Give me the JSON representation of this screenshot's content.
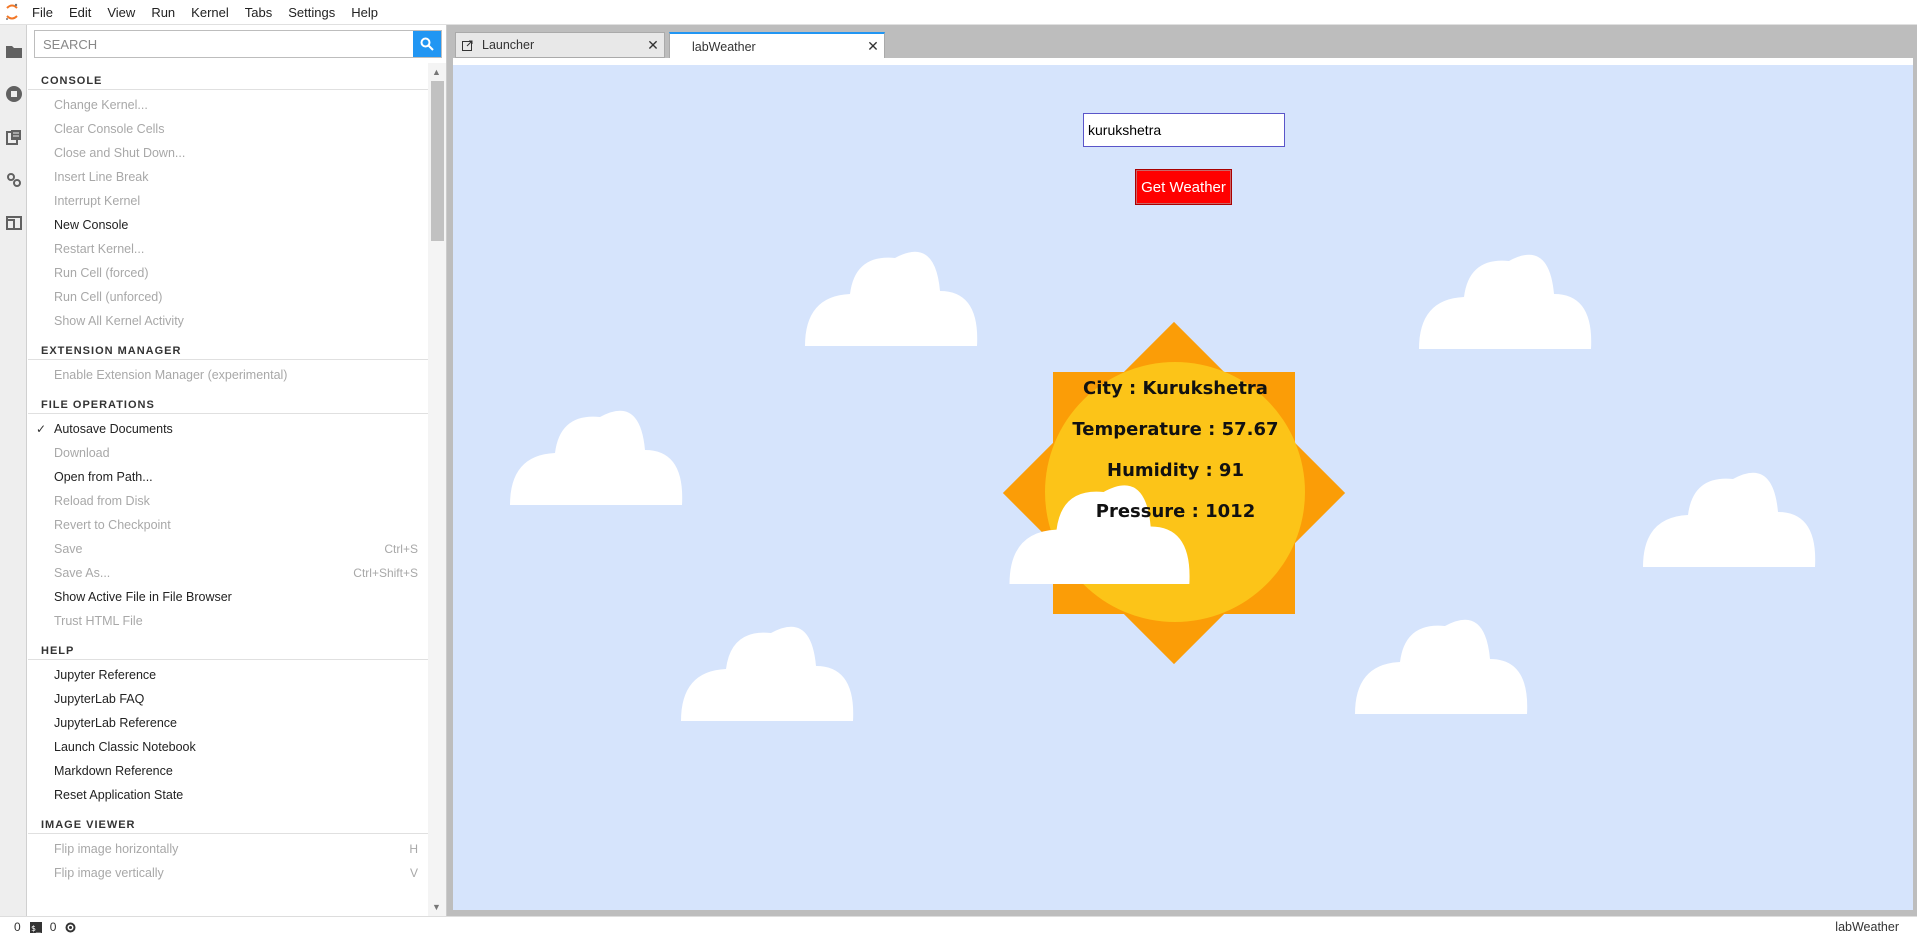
{
  "menubar": {
    "items": [
      "File",
      "Edit",
      "View",
      "Run",
      "Kernel",
      "Tabs",
      "Settings",
      "Help"
    ]
  },
  "activity_icons": [
    "folder-icon",
    "running-stop-icon",
    "commands-icon",
    "property-inspector-icon",
    "tabs-icon"
  ],
  "palette": {
    "search_placeholder": "SEARCH",
    "sections": [
      {
        "title": "CONSOLE",
        "items": [
          {
            "label": "Change Kernel...",
            "enabled": false
          },
          {
            "label": "Clear Console Cells",
            "enabled": false
          },
          {
            "label": "Close and Shut Down...",
            "enabled": false
          },
          {
            "label": "Insert Line Break",
            "enabled": false
          },
          {
            "label": "Interrupt Kernel",
            "enabled": false
          },
          {
            "label": "New Console",
            "enabled": true
          },
          {
            "label": "Restart Kernel...",
            "enabled": false
          },
          {
            "label": "Run Cell (forced)",
            "enabled": false
          },
          {
            "label": "Run Cell (unforced)",
            "enabled": false
          },
          {
            "label": "Show All Kernel Activity",
            "enabled": false
          }
        ]
      },
      {
        "title": "EXTENSION MANAGER",
        "items": [
          {
            "label": "Enable Extension Manager (experimental)",
            "enabled": false
          }
        ]
      },
      {
        "title": "FILE OPERATIONS",
        "items": [
          {
            "label": "Autosave Documents",
            "enabled": true,
            "checked": true
          },
          {
            "label": "Download",
            "enabled": false
          },
          {
            "label": "Open from Path...",
            "enabled": true
          },
          {
            "label": "Reload from Disk",
            "enabled": false
          },
          {
            "label": "Revert to Checkpoint",
            "enabled": false
          },
          {
            "label": "Save",
            "enabled": false,
            "shortcut": "Ctrl+S"
          },
          {
            "label": "Save As...",
            "enabled": false,
            "shortcut": "Ctrl+Shift+S"
          },
          {
            "label": "Show Active File in File Browser",
            "enabled": true
          },
          {
            "label": "Trust HTML File",
            "enabled": false
          }
        ]
      },
      {
        "title": "HELP",
        "items": [
          {
            "label": "Jupyter Reference",
            "enabled": true
          },
          {
            "label": "JupyterLab FAQ",
            "enabled": true
          },
          {
            "label": "JupyterLab Reference",
            "enabled": true
          },
          {
            "label": "Launch Classic Notebook",
            "enabled": true
          },
          {
            "label": "Markdown Reference",
            "enabled": true
          },
          {
            "label": "Reset Application State",
            "enabled": true
          }
        ]
      },
      {
        "title": "IMAGE VIEWER",
        "items": [
          {
            "label": "Flip image horizontally",
            "enabled": false,
            "shortcut": "H"
          },
          {
            "label": "Flip image vertically",
            "enabled": false,
            "shortcut": "V"
          }
        ]
      }
    ]
  },
  "tabs": [
    {
      "label": "Launcher",
      "active": false
    },
    {
      "label": "labWeather",
      "active": true
    }
  ],
  "weather": {
    "city_value": "kurukshetra",
    "button_label": "Get Weather",
    "city_line": "City : Kurukshetra",
    "temperature_line": "Temperature : 57.67",
    "humidity_line": "Humidity : 91",
    "pressure_line": "Pressure : 1012",
    "colors": {
      "sky": "#d6e4fc",
      "sun_rays": "#fb9d07",
      "sun_core": "#fcc418",
      "button": "#ff0000"
    }
  },
  "statusbar": {
    "terminals_count": "0",
    "kernels_count": "0",
    "active_doc": "labWeather"
  }
}
